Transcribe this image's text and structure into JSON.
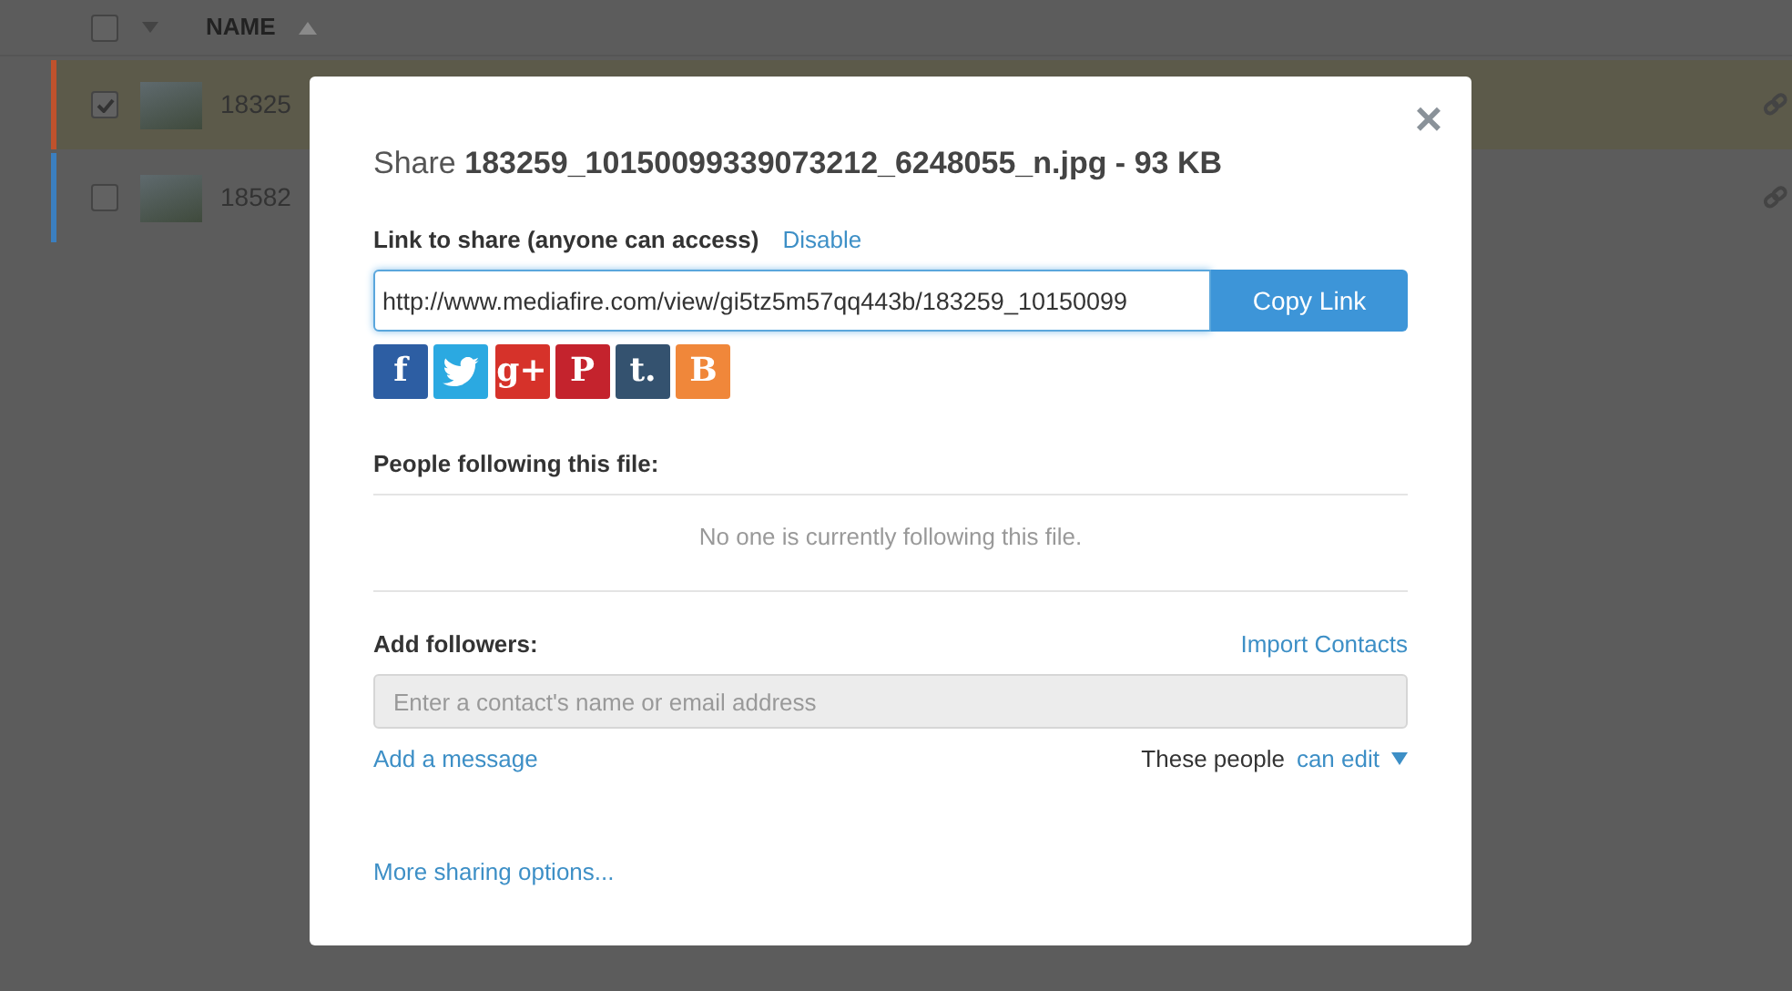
{
  "file_list": {
    "select_all_checked": false,
    "columns": [
      {
        "label": "NAME",
        "sorted": true
      }
    ],
    "rows": [
      {
        "name": "18325",
        "checked": true,
        "selected": true,
        "color": "#c0522c"
      },
      {
        "name": "18582",
        "checked": false,
        "selected": false,
        "color": "#3b7fc0"
      }
    ]
  },
  "dialog": {
    "title_prefix": "Share",
    "title": "183259_10150099339073212_6248055_n.jpg - 93 KB",
    "close": "×",
    "link_label": "Link to share (anyone can access)",
    "disable_link": "Disable",
    "link_value": "http://www.mediafire.com/view/gi5tz5m57qq443b/183259_10150099",
    "copy_button": "Copy Link",
    "social": [
      {
        "kind": "letter",
        "glyph": "f",
        "color": "#2d5ea3"
      },
      {
        "kind": "bird",
        "color": "#2ba9e1"
      },
      {
        "kind": "letter",
        "glyph": "g+",
        "color": "#d6322a"
      },
      {
        "kind": "letter",
        "glyph": "P",
        "color": "#c4232d"
      },
      {
        "kind": "letter",
        "glyph": "t.",
        "color": "#34526f"
      },
      {
        "kind": "letter",
        "glyph": "B",
        "color": "#f0873a"
      }
    ],
    "followers_heading": "People following this file:",
    "followers_empty": "No one is currently following this file.",
    "add_heading": "Add followers:",
    "import_link": "Import Contacts",
    "contact_placeholder": "Enter a contact's name or email address",
    "add_message": "Add a message",
    "permission_label": "These people",
    "permission_value": "can edit",
    "more_options": "More sharing options..."
  }
}
